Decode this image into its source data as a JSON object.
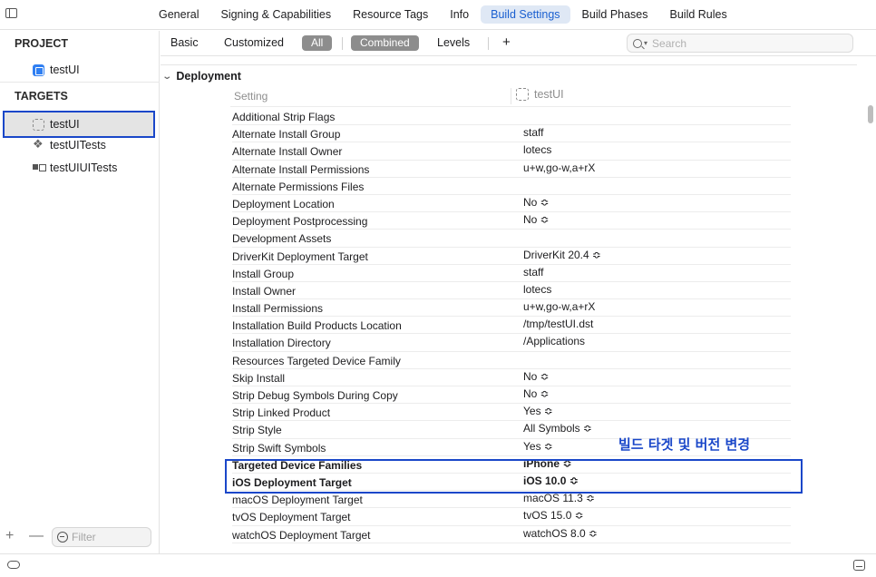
{
  "tabs": [
    {
      "label": "General"
    },
    {
      "label": "Signing & Capabilities"
    },
    {
      "label": "Resource Tags"
    },
    {
      "label": "Info"
    },
    {
      "label": "Build Settings"
    },
    {
      "label": "Build Phases"
    },
    {
      "label": "Build Rules"
    }
  ],
  "active_tab": "Build Settings",
  "sidebar": {
    "project_heading": "PROJECT",
    "project": "testUI",
    "targets_heading": "TARGETS",
    "targets": [
      {
        "label": "testUI"
      },
      {
        "label": "testUITests"
      },
      {
        "label": "testUIUITests"
      }
    ],
    "selected_target": "testUI",
    "filter_placeholder": "Filter",
    "add_symbol": "+",
    "remove_symbol": "—"
  },
  "filterbar": {
    "basic": "Basic",
    "customized": "Customized",
    "all": "All",
    "combined": "Combined",
    "levels": "Levels",
    "add_symbol": "+",
    "search_placeholder": "Search"
  },
  "content": {
    "section": "Deployment",
    "col_setting": "Setting",
    "col_target": "testUI",
    "rows": [
      {
        "name": "Additional Strip Flags",
        "value": ""
      },
      {
        "name": "Alternate Install Group",
        "value": "staff"
      },
      {
        "name": "Alternate Install Owner",
        "value": "lotecs"
      },
      {
        "name": "Alternate Install Permissions",
        "value": "u+w,go-w,a+rX"
      },
      {
        "name": "Alternate Permissions Files",
        "value": ""
      },
      {
        "name": "Deployment Location",
        "value": "No ≎"
      },
      {
        "name": "Deployment Postprocessing",
        "value": "No ≎"
      },
      {
        "name": "Development Assets",
        "value": ""
      },
      {
        "name": "DriverKit Deployment Target",
        "value": "DriverKit 20.4 ≎"
      },
      {
        "name": "Install Group",
        "value": "staff"
      },
      {
        "name": "Install Owner",
        "value": "lotecs"
      },
      {
        "name": "Install Permissions",
        "value": "u+w,go-w,a+rX"
      },
      {
        "name": "Installation Build Products Location",
        "value": "/tmp/testUI.dst"
      },
      {
        "name": "Installation Directory",
        "value": "/Applications"
      },
      {
        "name": "Resources Targeted Device Family",
        "value": ""
      },
      {
        "name": "Skip Install",
        "value": "No ≎"
      },
      {
        "name": "Strip Debug Symbols During Copy",
        "value": "No ≎"
      },
      {
        "name": "Strip Linked Product",
        "value": "Yes ≎"
      },
      {
        "name": "Strip Style",
        "value": "All Symbols ≎"
      },
      {
        "name": "Strip Swift Symbols",
        "value": "Yes ≎"
      },
      {
        "name": "Targeted Device Families",
        "value": "iPhone ≎"
      },
      {
        "name": "iOS Deployment Target",
        "value": "iOS 10.0 ≎"
      },
      {
        "name": "macOS Deployment Target",
        "value": "macOS 11.3 ≎"
      },
      {
        "name": "tvOS Deployment Target",
        "value": "tvOS 15.0 ≎"
      },
      {
        "name": "watchOS Deployment Target",
        "value": "watchOS 8.0 ≎"
      }
    ]
  },
  "annotation": "빌드 타겟 및 버전 변경",
  "colors": {
    "accent": "#1a5fd0",
    "annotation": "#1a47c9",
    "pill": "#8d8d8d"
  },
  "icons": {
    "sidebar_toggle": "sidebar-toggle-icon",
    "project": "app-icon",
    "target": "target-icon",
    "tests": "tests-icon",
    "uitests": "uitests-icon",
    "search": "search-icon",
    "filter": "filter-icon"
  }
}
